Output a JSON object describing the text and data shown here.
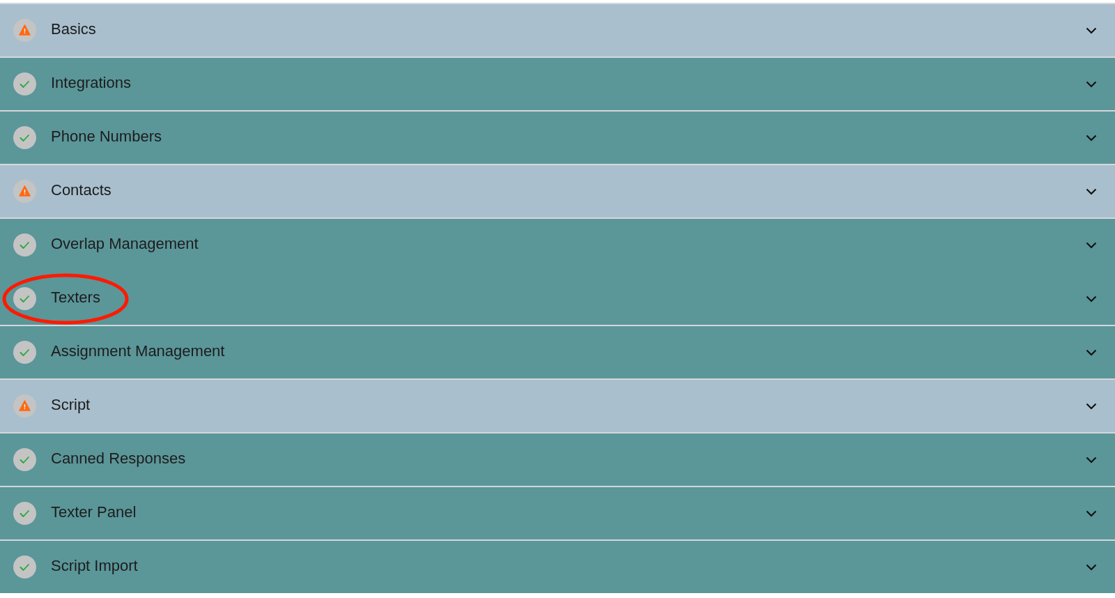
{
  "sections": [
    {
      "label": "Basics",
      "kind": "warning",
      "expanded": false,
      "divider": true,
      "circled": false
    },
    {
      "label": "Integrations",
      "kind": "done",
      "expanded": false,
      "divider": true,
      "circled": false
    },
    {
      "label": "Phone Numbers",
      "kind": "done",
      "expanded": false,
      "divider": true,
      "circled": false
    },
    {
      "label": "Contacts",
      "kind": "warning",
      "expanded": false,
      "divider": true,
      "circled": false
    },
    {
      "label": "Overlap Management",
      "kind": "done",
      "expanded": false,
      "divider": true,
      "circled": false
    },
    {
      "label": "Texters",
      "kind": "done",
      "expanded": false,
      "divider": false,
      "circled": true
    },
    {
      "label": "Assignment Management",
      "kind": "done",
      "expanded": false,
      "divider": true,
      "circled": false
    },
    {
      "label": "Script",
      "kind": "warning",
      "expanded": false,
      "divider": true,
      "circled": false
    },
    {
      "label": "Canned Responses",
      "kind": "done",
      "expanded": false,
      "divider": true,
      "circled": false
    },
    {
      "label": "Texter Panel",
      "kind": "done",
      "expanded": false,
      "divider": true,
      "circled": false
    },
    {
      "label": "Script Import",
      "kind": "done",
      "expanded": false,
      "divider": true,
      "circled": false
    }
  ]
}
